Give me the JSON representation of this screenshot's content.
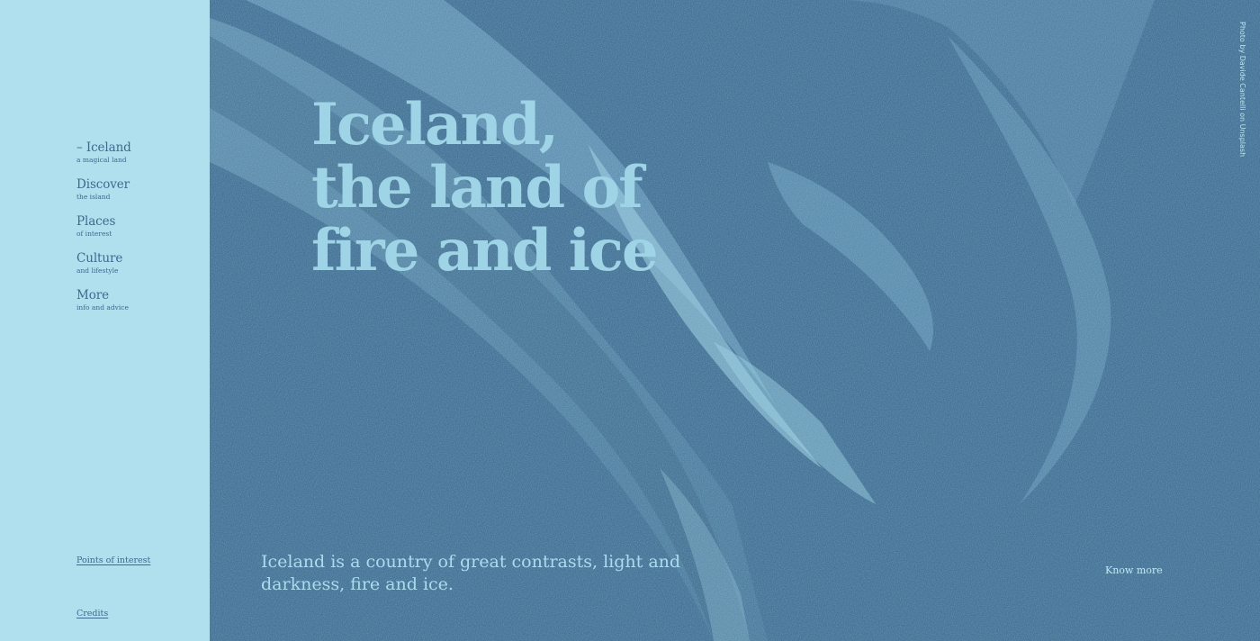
{
  "sidebar": {
    "nav": [
      {
        "title": "– Iceland",
        "subtitle": "a magical land"
      },
      {
        "title": "Discover",
        "subtitle": "the island"
      },
      {
        "title": "Places",
        "subtitle": "of interest"
      },
      {
        "title": "Culture",
        "subtitle": "and lifestyle"
      },
      {
        "title": "More",
        "subtitle": "info and advice"
      }
    ],
    "points_of_interest": "Points of interest",
    "credits": "Credits"
  },
  "hero": {
    "headline": [
      "Iceland,",
      "the land of",
      "fire and ice"
    ],
    "intro": "Iceland is a country of great contrasts, light and darkness, fire and ice.",
    "know_more": "Know more",
    "photo_credit": "Photo by Davide Cantelli on Unsplash"
  },
  "colors": {
    "sidebar_bg": "#b0dfed",
    "hero_bg": "#437296",
    "headline": "#9ed4e6",
    "nav_text": "#3e6a8e"
  }
}
